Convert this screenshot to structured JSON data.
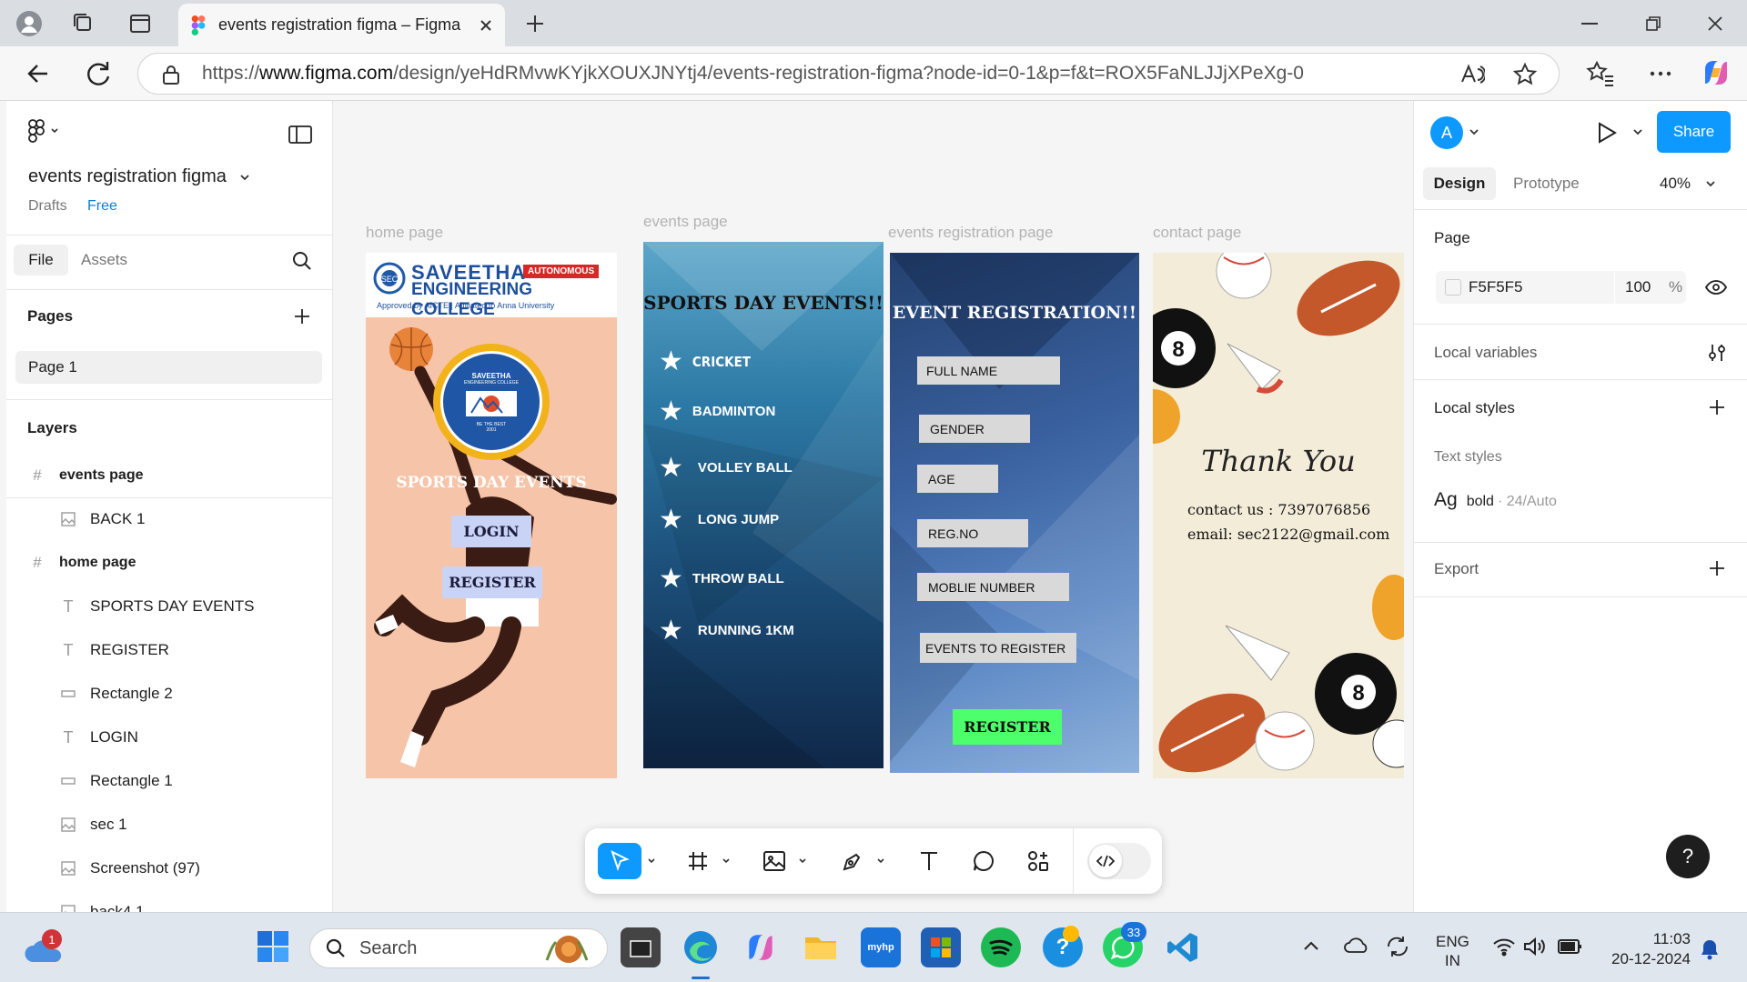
{
  "browser": {
    "tab_title": "events registration figma – Figma",
    "url_prefix": "https://",
    "url_host": "www.figma.com",
    "url_path": "/design/yeHdRMvwKYjkXOUXJNYtj4/events-registration-figma?node-id=0-1&p=f&t=ROX5FaNLJJjXPeXg-0"
  },
  "left_panel": {
    "file_name": "events registration figma",
    "location": "Drafts",
    "plan": "Free",
    "tabs": [
      "File",
      "Assets"
    ],
    "pages_heading": "Pages",
    "current_page": "Page 1",
    "layers_heading": "Layers",
    "layers": [
      {
        "name": "events page",
        "type": "frame"
      },
      {
        "name": "BACK 1",
        "type": "image"
      },
      {
        "name": "home page",
        "type": "frame"
      },
      {
        "name": "SPORTS DAY EVENTS",
        "type": "text"
      },
      {
        "name": "REGISTER",
        "type": "text"
      },
      {
        "name": "Rectangle 2",
        "type": "rect"
      },
      {
        "name": "LOGIN",
        "type": "text"
      },
      {
        "name": "Rectangle 1",
        "type": "rect"
      },
      {
        "name": "sec 1",
        "type": "image"
      },
      {
        "name": "Screenshot (97)",
        "type": "image"
      },
      {
        "name": "back4 1",
        "type": "image"
      }
    ]
  },
  "canvas": {
    "frames": {
      "home": {
        "label": "home page",
        "college_name_1": "SAVEETHA",
        "college_badge": "AUTONOMOUS",
        "college_name_2": "ENGINEERING COLLEGE",
        "college_sub": "Approved by AICTE | Affiliated to Anna University",
        "seal_top": "SAVEETHA",
        "seal_mid": "ENGINEERING COLLEGE",
        "seal_motto": "BE THE BEST",
        "seal_year": "2001",
        "logo_mark": "SEC",
        "title": "SPORTS DAY EVENTS",
        "login": "LOGIN",
        "register": "REGISTER"
      },
      "events": {
        "label": "events page",
        "title": "SPORTS DAY EVENTS!!",
        "items": [
          "CRICKET",
          "BADMINTON",
          "VOLLEY BALL",
          "LONG JUMP",
          "THROW BALL",
          "RUNNING 1KM"
        ]
      },
      "registration": {
        "label": "events registration page",
        "title": "EVENT REGISTRATION!!",
        "fields": [
          "FULL NAME",
          "GENDER",
          "AGE",
          "REG.NO",
          "MOBLIE NUMBER",
          "EVENTS TO REGISTER"
        ],
        "button": "REGISTER"
      },
      "contact": {
        "label": "contact page",
        "thanks": "Thank You",
        "contact": "contact us : 7397076856",
        "email": "email: sec2122@gmail.com"
      }
    }
  },
  "right_panel": {
    "avatar": "A",
    "share": "Share",
    "tabs": [
      "Design",
      "Prototype"
    ],
    "zoom": "40%",
    "page_heading": "Page",
    "bg_hex": "F5F5F5",
    "bg_opacity": "100",
    "bg_opacity_unit": "%",
    "local_variables": "Local variables",
    "local_styles": "Local styles",
    "text_styles": "Text styles",
    "style_sample": "Ag",
    "style_name": "bold",
    "style_meta": "· 24/Auto",
    "export": "Export",
    "help": "?"
  },
  "taskbar": {
    "weather_badge": "1",
    "search": "Search",
    "whatsapp_badge": "33",
    "lang1": "ENG",
    "lang2": "IN",
    "time": "11:03",
    "date": "20-12-2024"
  },
  "colors": {
    "figma_blue": "#0d99ff",
    "home_bg": "#f6c4a8",
    "events_bg": "#2e6f92",
    "registration_bg": "#3d68a6",
    "register_button": "#4dff6b",
    "contact_bg": "#f3ecd9"
  }
}
